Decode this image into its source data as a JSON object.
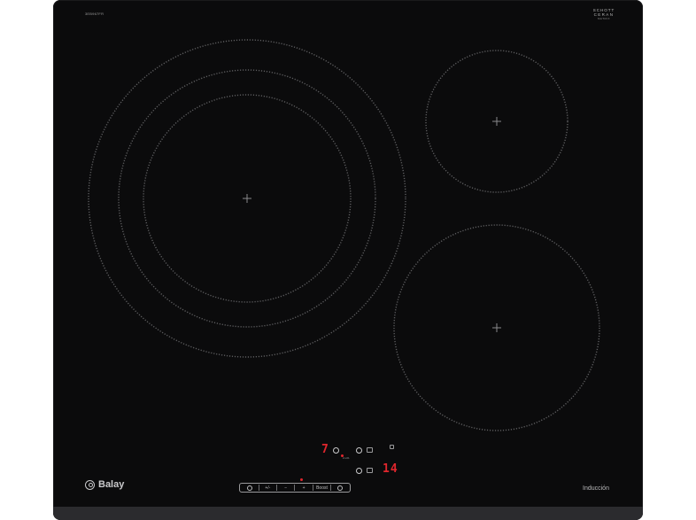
{
  "product": {
    "model_code": "3EB967FR",
    "glass_brand_line1": "SCHOTT",
    "glass_brand_line2": "CERAN",
    "glass_brand_line3": "MATRIX",
    "brand_name": "Balay",
    "type_label": "Inducción"
  },
  "display": {
    "left_zone_level": "7",
    "right_zone_level": "14",
    "aux_label": "2-L01"
  },
  "controls": {
    "power_label": "",
    "plus_minus_label": "+/-",
    "minus_label": "−",
    "plus_label": "+",
    "boost_label": "Boost",
    "timer_label": ""
  },
  "colors": {
    "glass": "#0b0b0c",
    "zone_outline": "#5a5a5c",
    "display_red": "#e0262d",
    "print_gray": "#bdbdbf"
  }
}
